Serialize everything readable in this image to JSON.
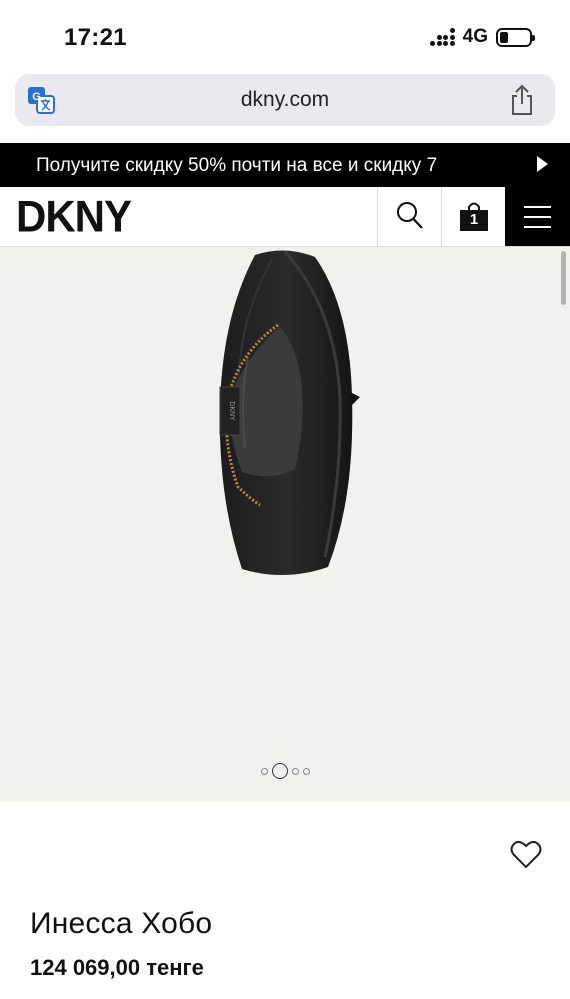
{
  "status_bar": {
    "time": "17:21",
    "network": "4G",
    "battery_level": 0.3,
    "icons": [
      "signal-icon",
      "battery-icon"
    ]
  },
  "browser": {
    "url": "dkny.com",
    "icons": [
      "translate-icon",
      "share-icon"
    ]
  },
  "promo_banner": {
    "text": "Получите скидку 50% почти на все и скидку 7",
    "icon": "play-arrow-icon"
  },
  "header": {
    "logo": "DKNY",
    "cart_count": "1",
    "icons": [
      "search-icon",
      "shopping-bag-icon",
      "menu-icon"
    ]
  },
  "gallery": {
    "slide_count": 4,
    "active_slide": 2,
    "bag_label": "DKNY",
    "background": "#f3f1ee"
  },
  "product": {
    "name": "Инесса Хобо",
    "price": "124 069,00 тенге",
    "icon": "heart-icon"
  },
  "colors": {
    "banner_bg": "#000000",
    "accent": "#000000",
    "url_bar_bg": "#e9e9ee"
  }
}
